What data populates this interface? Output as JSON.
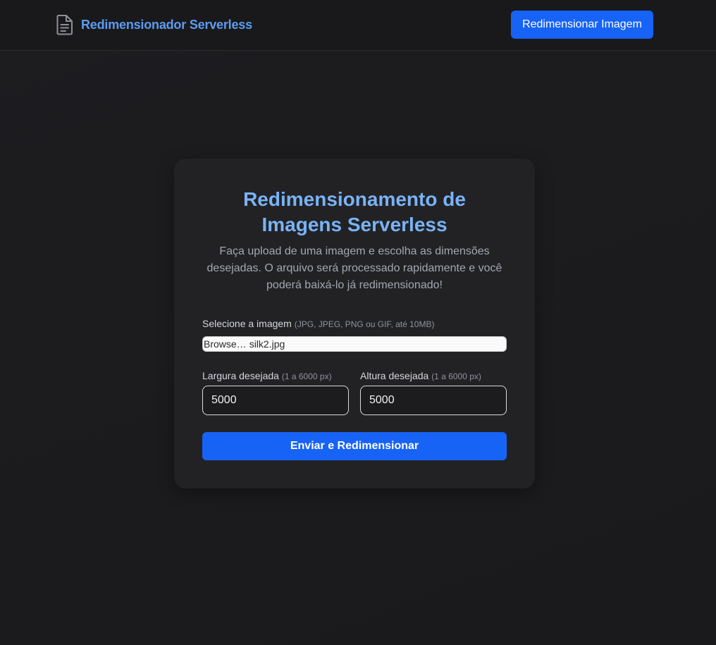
{
  "header": {
    "brand_name": "Redimensionador Serverless",
    "brand_icon": "document-icon",
    "action_label": "Redimensionar Imagem"
  },
  "card": {
    "title": "Redimensionamento de Imagens Serverless",
    "description": "Faça upload de uma imagem e escolha as dimensões desejadas. O arquivo será processado rapidamente e você poderá baixá-lo já redimensionado!",
    "file": {
      "label": "Selecione a imagem",
      "hint": "(JPG, JPEG, PNG ou GIF, até 10MB)",
      "browse_label": "Browse…",
      "file_name": "silk2.jpg"
    },
    "width": {
      "label": "Largura desejada",
      "hint": "(1 a 6000 px)",
      "value": "5000"
    },
    "height": {
      "label": "Altura desejada",
      "hint": "(1 a 6000 px)",
      "value": "5000"
    },
    "submit_label": "Enviar e Redimensionar"
  },
  "colors": {
    "accent": "#1763f5",
    "brand_text": "#5b9cf1",
    "title_text": "#79b3f5",
    "background": "#1c1c1e",
    "card": "#222225"
  }
}
